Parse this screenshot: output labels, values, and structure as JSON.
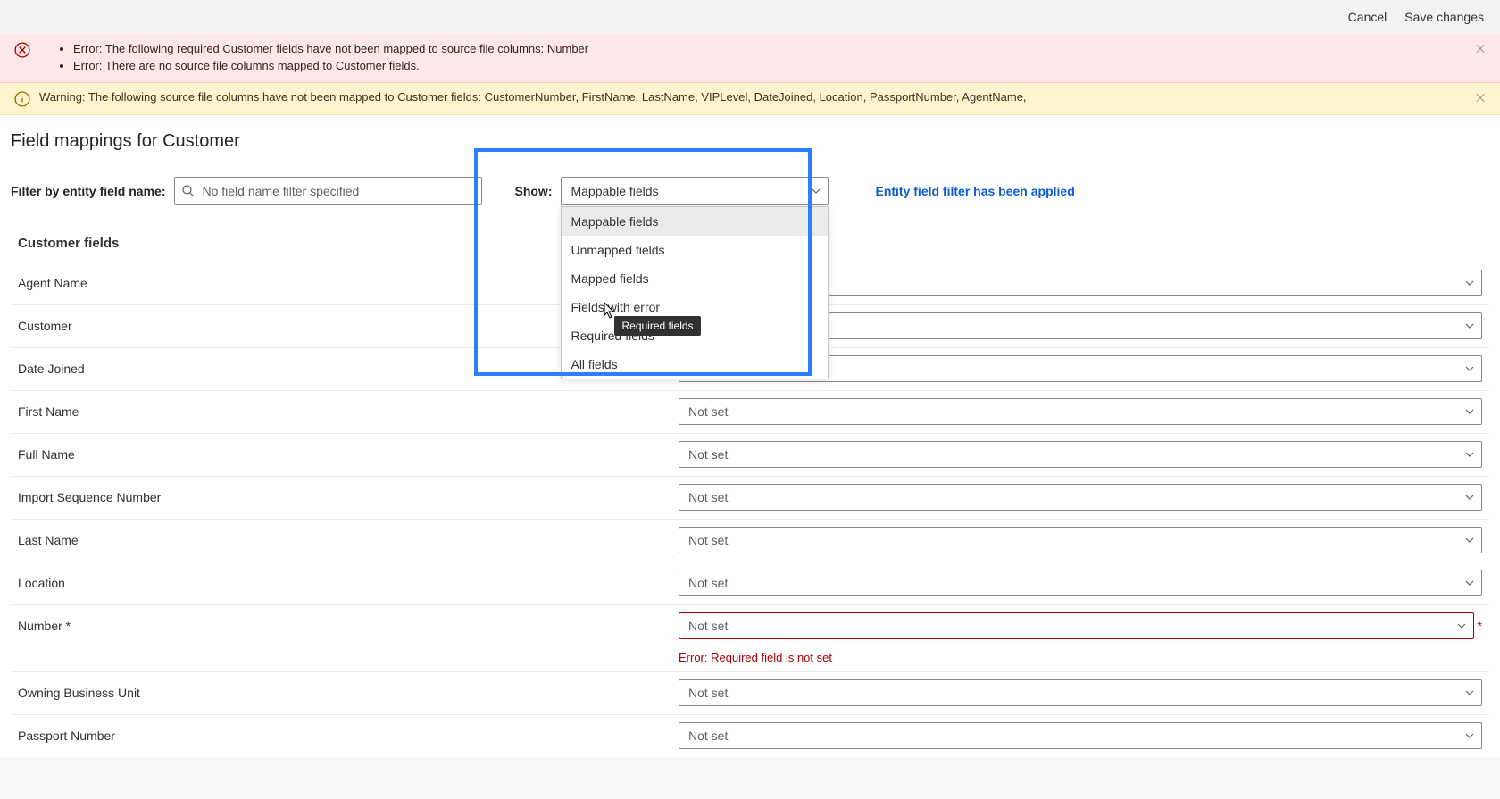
{
  "topbar": {
    "cancel": "Cancel",
    "save": "Save changes"
  },
  "alerts": {
    "error_items": [
      "Error: The following required Customer fields have not been mapped to source file columns: Number",
      "Error: There are no source file columns mapped to Customer fields."
    ],
    "warning": "Warning: The following source file columns have not been mapped to Customer fields: CustomerNumber, FirstName, LastName, VIPLevel, DateJoined, Location, PassportNumber, AgentName,"
  },
  "page_title": "Field mappings for Customer",
  "filter": {
    "label": "Filter by entity field name:",
    "placeholder": "No field name filter specified",
    "show_label": "Show:",
    "selected": "Mappable fields",
    "options": [
      "Mappable fields",
      "Unmapped fields",
      "Mapped fields",
      "Fields with error",
      "Required fields",
      "All fields"
    ],
    "tooltip": "Required fields",
    "applied_msg": "Entity field filter has been applied"
  },
  "section_heading": "Customer fields",
  "not_set": "Not set",
  "fields": [
    {
      "label": "Agent Name"
    },
    {
      "label": "Customer"
    },
    {
      "label": "Date Joined"
    },
    {
      "label": "First Name"
    },
    {
      "label": "Full Name"
    },
    {
      "label": "Import Sequence Number"
    },
    {
      "label": "Last Name"
    },
    {
      "label": "Location"
    },
    {
      "label": "Number *"
    },
    {
      "label": "Owning Business Unit"
    },
    {
      "label": "Passport Number"
    }
  ],
  "row_error": "Error: Required field is not set"
}
